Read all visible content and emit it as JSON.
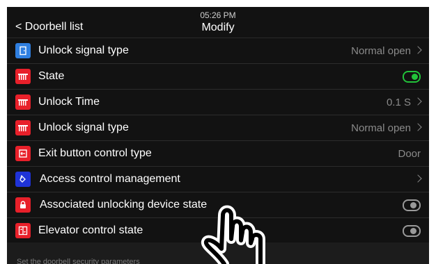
{
  "header": {
    "time": "05:26 PM",
    "title": "Modify",
    "back_label": "< Doorbell list"
  },
  "colors": {
    "background": "#121212",
    "red_icon": "#e8202a",
    "blue_icon": "#2f7fe0",
    "indigo_icon": "#1f33d8",
    "toggle_on": "#22c33a",
    "toggle_off": "#9a9a9a"
  },
  "rows": [
    {
      "label": "Unlock signal type",
      "value": "Normal open",
      "icon": "door-icon",
      "chevron": true
    },
    {
      "label": "State",
      "toggle": true,
      "toggle_on": true,
      "icon": "gate-icon"
    },
    {
      "label": "Unlock Time",
      "value": "0.1 S",
      "icon": "gate-icon",
      "chevron": true
    },
    {
      "label": "Unlock signal type",
      "value": "Normal open",
      "icon": "gate-icon",
      "chevron": true
    },
    {
      "label": "Exit button control type",
      "value": "Door",
      "icon": "exit-button-icon",
      "chevron": false
    },
    {
      "label": "Access control management",
      "value": "",
      "icon": "tag-icon",
      "chevron": true
    },
    {
      "label": "Associated unlocking device state",
      "toggle": true,
      "toggle_on": false,
      "icon": "lock-icon"
    },
    {
      "label": "Elevator control state",
      "toggle": true,
      "toggle_on": false,
      "icon": "elevator-icon"
    }
  ],
  "footer": {
    "hint": "Set the doorbell security parameters"
  }
}
